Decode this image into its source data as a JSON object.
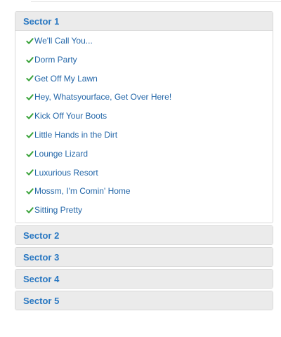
{
  "accordion": {
    "sectors": [
      {
        "title": "Sector 1",
        "expanded": true,
        "items": [
          "We'll Call You...",
          "Dorm Party",
          "Get Off My Lawn",
          "Hey, Whatsyourface, Get Over Here!",
          "Kick Off Your Boots",
          "Little Hands in the Dirt",
          "Lounge Lizard",
          "Luxurious Resort",
          "Mossm, I'm Comin' Home",
          "Sitting Pretty"
        ]
      },
      {
        "title": "Sector 2",
        "expanded": false
      },
      {
        "title": "Sector 3",
        "expanded": false
      },
      {
        "title": "Sector 4",
        "expanded": false
      },
      {
        "title": "Sector 5",
        "expanded": false
      }
    ]
  },
  "icons": {
    "item_icon": "checkmark-icon"
  },
  "colors": {
    "accent_text": "#2a78c2",
    "item_text": "#2366a8",
    "check_green": "#3aa33a",
    "header_bg": "#ebebeb"
  }
}
